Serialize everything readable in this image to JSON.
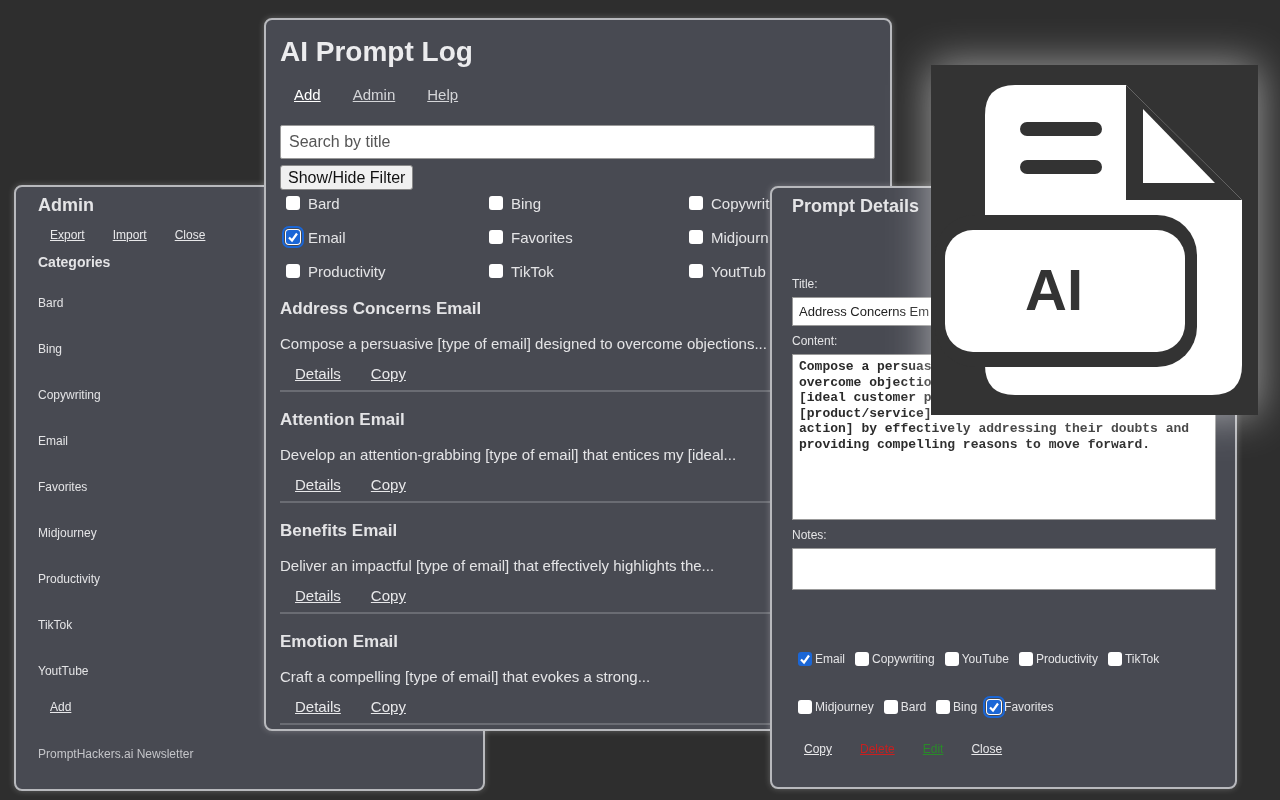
{
  "admin_window": {
    "title": "Admin",
    "links": [
      "Export",
      "Import",
      "Close"
    ],
    "categories_heading": "Categories",
    "categories": [
      "Bard",
      "Bing",
      "Copywriting",
      "Email",
      "Favorites",
      "Midjourney",
      "Productivity",
      "TikTok",
      "YoutTube"
    ],
    "add_link": "Add",
    "newsletter": "PromptHackers.ai Newsletter"
  },
  "main_window": {
    "title": "AI Prompt Log",
    "nav": [
      {
        "label": "Add",
        "selected": true
      },
      {
        "label": "Admin",
        "selected": false
      },
      {
        "label": "Help",
        "selected": false
      }
    ],
    "search": {
      "placeholder": "Search by title"
    },
    "filter_button": "Show/Hide Filter",
    "filters": [
      {
        "label": "Bard",
        "checked": false,
        "focused": false
      },
      {
        "label": "Bing",
        "checked": false,
        "focused": false
      },
      {
        "label": "Copywrit",
        "checked": false,
        "focused": false
      },
      {
        "label": "Email",
        "checked": true,
        "focused": true
      },
      {
        "label": "Favorites",
        "checked": false,
        "focused": false
      },
      {
        "label": "Midjourn",
        "checked": false,
        "focused": false
      },
      {
        "label": "Productivity",
        "checked": false,
        "focused": false
      },
      {
        "label": "TikTok",
        "checked": false,
        "focused": false
      },
      {
        "label": "YoutTub",
        "checked": false,
        "focused": false
      }
    ],
    "prompts": [
      {
        "title": "Address Concerns Email",
        "summary": "Compose a persuasive [type of email] designed to overcome objections...",
        "links": [
          "Details",
          "Copy"
        ]
      },
      {
        "title": "Attention Email",
        "summary": "Develop an attention-grabbing [type of email] that entices my [ideal...",
        "links": [
          "Details",
          "Copy"
        ]
      },
      {
        "title": "Benefits Email",
        "summary": "Deliver an impactful [type of email] that effectively highlights the...",
        "links": [
          "Details",
          "Copy"
        ]
      },
      {
        "title": "Emotion Email",
        "summary": "Craft a compelling [type of email] that evokes a strong...",
        "links": [
          "Details",
          "Copy"
        ]
      }
    ]
  },
  "details_window": {
    "title": "Prompt Details",
    "title_field": {
      "label": "Title:",
      "value": "Address Concerns Em"
    },
    "content_field": {
      "label": "Content:",
      "lines": [
        "Compose a persuas",
        "overcome objectio",
        "[ideal customer p",
        "[product/service]",
        "action] by effectively addressing their doubts and",
        "providing compelling reasons to move forward."
      ]
    },
    "notes_field": {
      "label": "Notes:"
    },
    "tag_rows": [
      [
        {
          "label": "Email",
          "checked": true,
          "focused": false
        },
        {
          "label": "Copywriting",
          "checked": false,
          "focused": false
        },
        {
          "label": "YouTube",
          "checked": false,
          "focused": false
        },
        {
          "label": "Productivity",
          "checked": false,
          "focused": false
        },
        {
          "label": "TikTok",
          "checked": false,
          "focused": false
        }
      ],
      [
        {
          "label": "Midjourney",
          "checked": false,
          "focused": false
        },
        {
          "label": "Bard",
          "checked": false,
          "focused": false
        },
        {
          "label": "Bing",
          "checked": false,
          "focused": false
        },
        {
          "label": "Favorites",
          "checked": true,
          "focused": true
        }
      ]
    ],
    "actions": [
      {
        "label": "Copy",
        "kind": "default"
      },
      {
        "label": "Delete",
        "kind": "danger"
      },
      {
        "label": "Edit",
        "kind": "success"
      },
      {
        "label": "Close",
        "kind": "default"
      }
    ]
  },
  "logo": {
    "label": "AI"
  }
}
